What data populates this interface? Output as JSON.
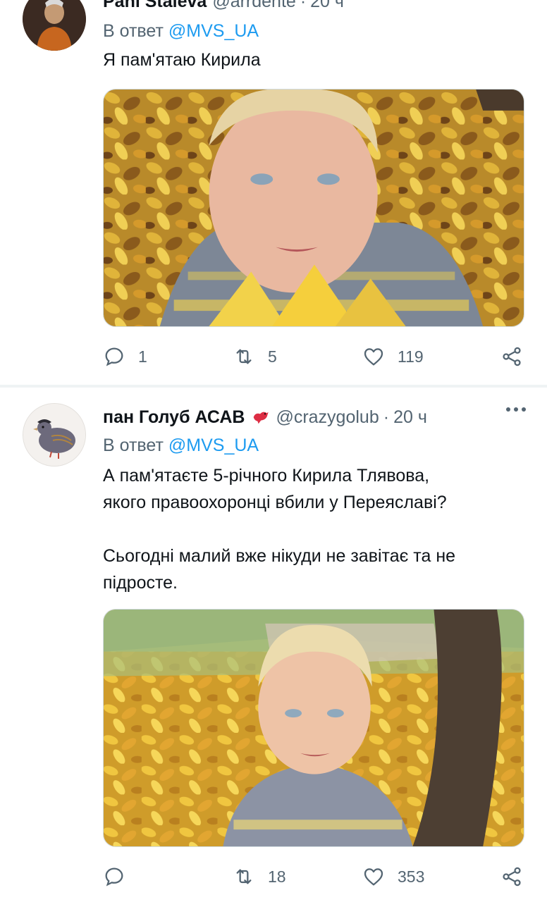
{
  "tweets": [
    {
      "display_name": "Pani Staleva",
      "handle": "@arrdente",
      "time": "20 ч",
      "reply_prefix": "В ответ",
      "reply_to": "@MVS_UA",
      "text_lines": [
        "Я пам'ятаю Кирила"
      ],
      "media": "photo-boy-in-autumn-leaves",
      "counts": {
        "replies": "1",
        "retweets": "5",
        "likes": "119"
      }
    },
    {
      "display_name": "пан Голуб АСАВ",
      "handle": "@crazygolub",
      "time": "20 ч",
      "reply_prefix": "В ответ",
      "reply_to": "@MVS_UA",
      "text_lines": [
        "А пам'ятаєте 5-річного Кирила Тлявова,",
        "якого правоохоронці вбили у Переяславі?",
        "",
        "Сьогодні малий вже нікуди не завітає та не",
        "підросте."
      ],
      "media": "photo-boy-in-park",
      "counts": {
        "replies": "",
        "retweets": "18",
        "likes": "353"
      }
    }
  ],
  "icons": {
    "reply": "reply-icon",
    "retweet": "retweet-icon",
    "like": "heart-icon",
    "share": "share-icon",
    "more": "more-icon",
    "emoji": "bird-emoji-icon"
  },
  "colors": {
    "link": "#1d9bf0",
    "secondary": "#536471",
    "primary": "#0f1419",
    "separator": "#eff3f4"
  }
}
